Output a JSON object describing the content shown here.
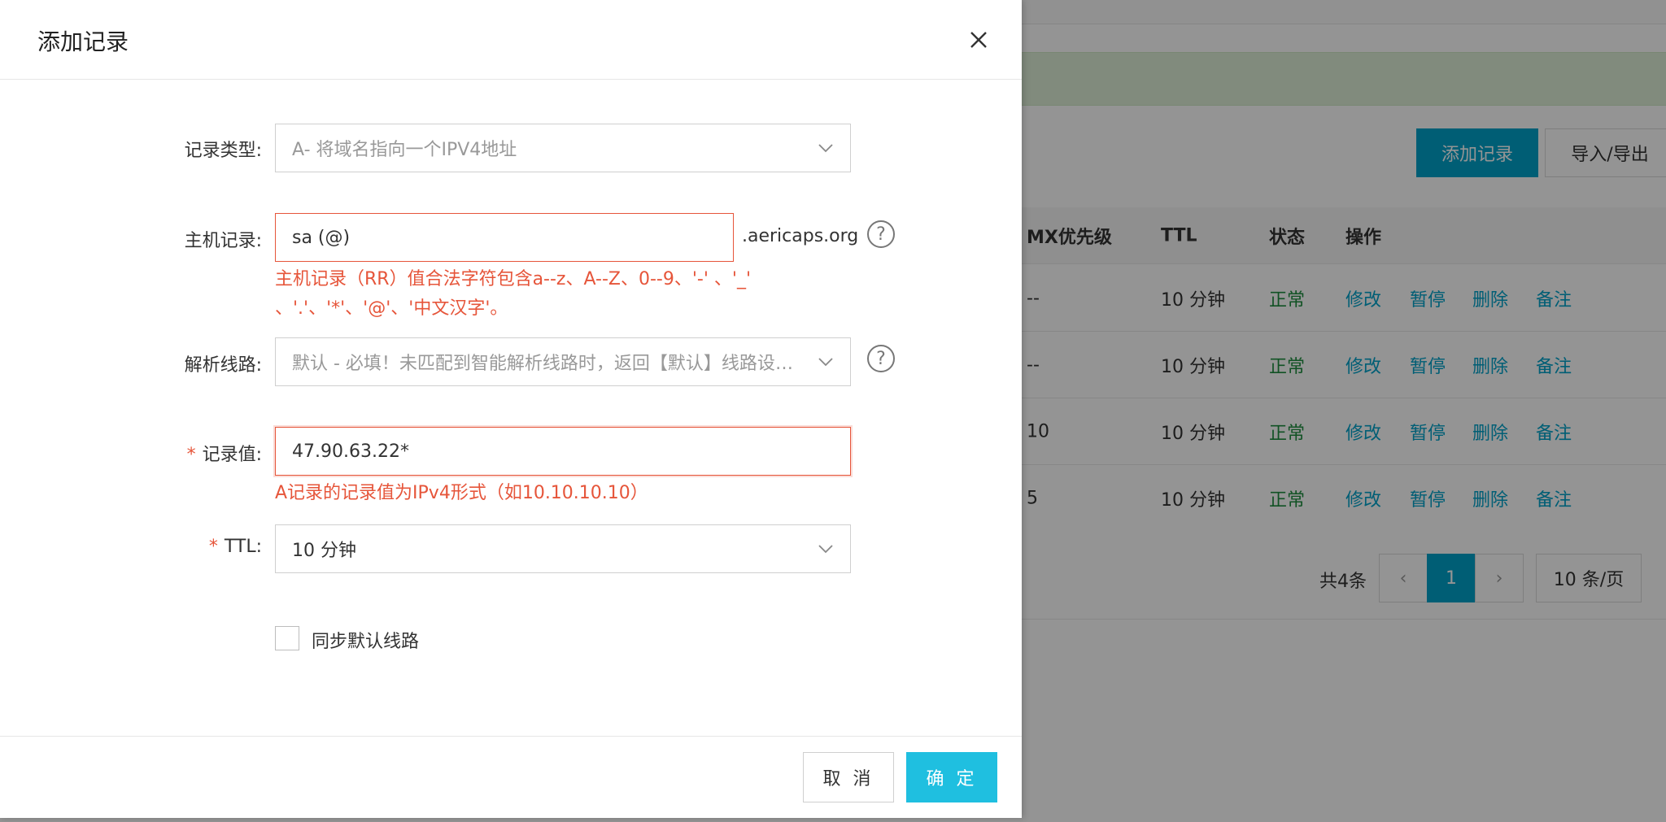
{
  "background": {
    "add_button": "添加记录",
    "io_button": "导入/导出",
    "table": {
      "headers": [
        "MX优先级",
        "TTL",
        "状态",
        "操作"
      ],
      "rows": [
        {
          "mx": "--",
          "ttl": "10 分钟",
          "status": "正常"
        },
        {
          "mx": "--",
          "ttl": "10 分钟",
          "status": "正常"
        },
        {
          "mx": "10",
          "ttl": "10 分钟",
          "status": "正常"
        },
        {
          "mx": "5",
          "ttl": "10 分钟",
          "status": "正常"
        }
      ],
      "actions": [
        "修改",
        "暂停",
        "删除",
        "备注"
      ]
    },
    "pagination": {
      "total": "共4条",
      "prev": "‹",
      "current": "1",
      "next": "›",
      "page_size": "10 条/页"
    }
  },
  "dialog": {
    "title": "添加记录",
    "record_type": {
      "label": "记录类型:",
      "value": "A- 将域名指向一个IPV4地址"
    },
    "host": {
      "label": "主机记录:",
      "value": "sa (@)",
      "suffix": ".aericaps.org",
      "help": "?",
      "error_line1": "主机记录（RR）值合法字符包含a--z、A--Z、0--9、'-' 、'_'",
      "error_line2": "、'.'、'*'、'@'、'中文汉字'。"
    },
    "line": {
      "label": "解析线路:",
      "value": "默认 - 必填！未匹配到智能解析线路时，返回【默认】线路设置...",
      "help": "?"
    },
    "record_value": {
      "required_mark": "*",
      "label": "记录值:",
      "value": "47.90.63.22*",
      "error": "A记录的记录值为IPv4形式（如10.10.10.10）"
    },
    "ttl": {
      "required_mark": "*",
      "label": "TTL:",
      "value": "10 分钟"
    },
    "sync_checkbox": {
      "label": "同步默认线路",
      "checked": false
    },
    "buttons": {
      "cancel": "取 消",
      "ok": "确 定"
    }
  }
}
